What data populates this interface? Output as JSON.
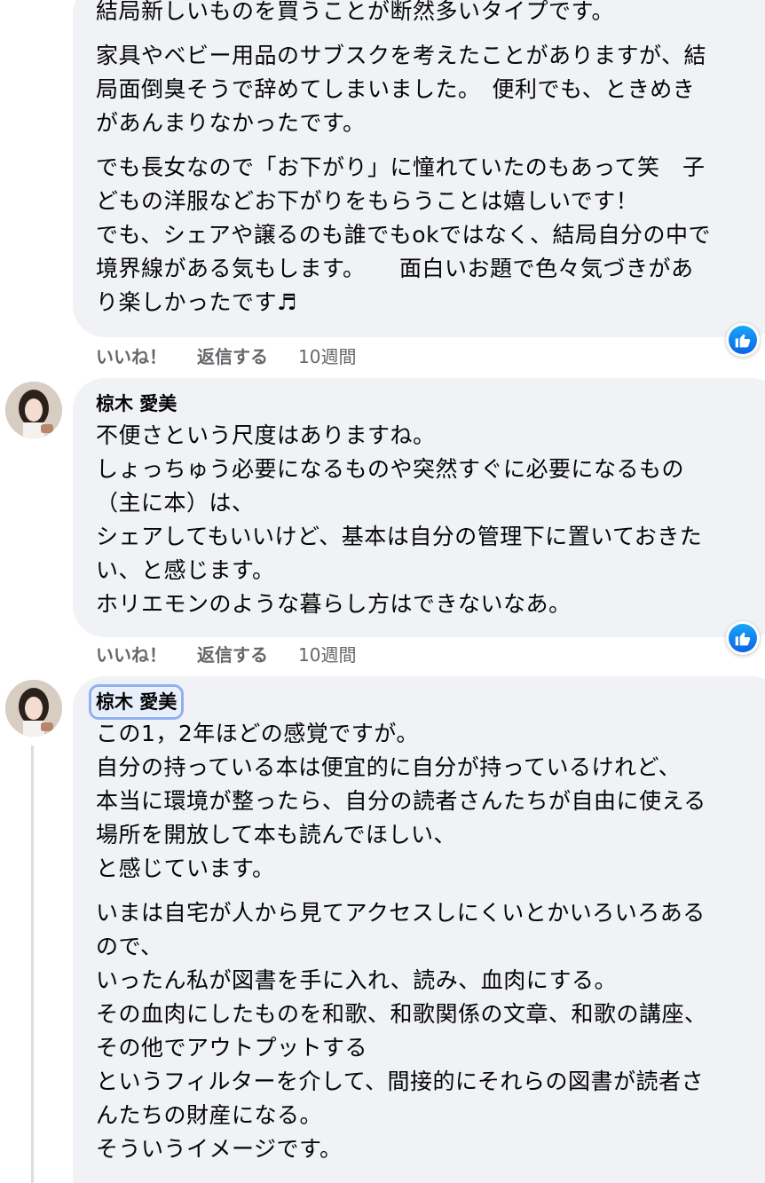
{
  "comments": [
    {
      "paragraphs": [
        [
          "結局新しいものを買うことが断然多いタイプです。"
        ],
        [
          "家具やベビー用品のサブスクを考えたことがありますが、結",
          "局面倒臭そうで辞めてしまいました。　便利でも、ときめき",
          "があんまりなかったです。"
        ],
        [
          "でも長女なので「お下がり」に憧れていたのもあって笑　子",
          "どもの洋服などお下がりをもらうことは嬉しいです！",
          "でも、シェアや譲るのも誰でもokではなく、結局自分の中で",
          "境界線がある気もします。　　面白いお題で色々気づきがあ",
          "り楽しかったです♬"
        ]
      ],
      "actions": {
        "like": "いいね！",
        "reply": "返信する",
        "time": "10週間"
      }
    },
    {
      "author": "椋木 愛美",
      "paragraphs": [
        [
          "不便さという尺度はありますね。",
          "しょっちゅう必要になるものや突然すぐに必要になるもの",
          "（主に本）は、",
          "シェアしてもいいけど、基本は自分の管理下に置いておきた",
          "い、と感じます。",
          "ホリエモンのような暮らし方はできないなあ。"
        ]
      ],
      "actions": {
        "like": "いいね！",
        "reply": "返信する",
        "time": "10週間"
      }
    },
    {
      "author": "椋木 愛美",
      "paragraphs": [
        [
          "この1，2年ほどの感覚ですが。",
          "自分の持っている本は便宜的に自分が持っているけれど、",
          "本当に環境が整ったら、自分の読者さんたちが自由に使える",
          "場所を開放して本も読んでほしい、",
          "と感じています。"
        ],
        [
          "いまは自宅が人から見てアクセスしにくいとかいろいろある",
          "ので、",
          "いったん私が図書を手に入れ、読み、血肉にする。",
          "その血肉にしたものを和歌、和歌関係の文章、和歌の講座、",
          "その他でアウトプットする",
          "というフィルターを介して、間接的にそれらの図書が読者さ",
          "んたちの財産になる。",
          "そういうイメージです。"
        ]
      ]
    }
  ],
  "icons": {
    "reaction": "like-thumb-icon",
    "avatar": "profile-photo"
  },
  "colors": {
    "bubble": "#f0f2f5",
    "meta": "#65676b",
    "like_blue": "#1877f2",
    "focus": "#8fb1f4"
  }
}
